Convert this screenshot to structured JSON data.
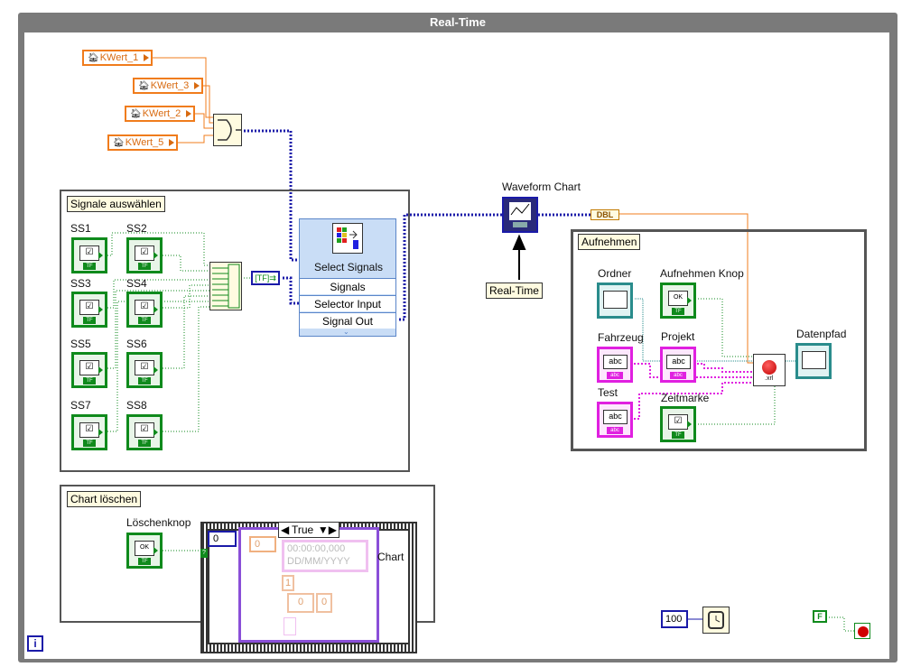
{
  "window": {
    "title": "Real-Time"
  },
  "constants": [
    {
      "label": "KWert_1"
    },
    {
      "label": "KWert_3"
    },
    {
      "label": "KWert_2"
    },
    {
      "label": "KWert_5"
    }
  ],
  "signals_struct": {
    "title": "Signale auswählen",
    "switches": [
      "SS1",
      "SS2",
      "SS3",
      "SS4",
      "SS5",
      "SS6",
      "SS7",
      "SS8"
    ]
  },
  "select_signals": {
    "title": "Select Signals",
    "ports": [
      "Signals",
      "Selector Input",
      "Signal Out"
    ]
  },
  "waveform": {
    "label": "Waveform Chart",
    "dbl": "DBL",
    "realtime_label": "Real-Time"
  },
  "record_struct": {
    "title": "Aufnehmen",
    "ordner": "Ordner",
    "aufnehmen_knop": "Aufnehmen Knop",
    "fahrzeug": "Fahrzeug",
    "projekt": "Projekt",
    "test": "Test",
    "zeitmarke": "Zeitmarke",
    "datenpfad": "Datenpfad"
  },
  "chart_struct": {
    "title": "Chart löschen",
    "loeschen": "Löschenknop",
    "case_value": "True",
    "index_val": "0",
    "inner_index": "0",
    "time_text": "00:00:00,000",
    "date_text": "DD/MM/YYYY",
    "one": "1",
    "zero_a": "0",
    "zero_b": "0",
    "chart_label": "Chart"
  },
  "wait": {
    "value": "100"
  },
  "stop": {
    "value": "F"
  },
  "info": {
    "icon": "i"
  },
  "colors": {
    "frame": "#7a7a7a",
    "bool": "#0f8a1c",
    "string": "#e020e0",
    "const": "#f07c1c",
    "dyn": "#1a1aa8",
    "path": "#2a8c8c"
  }
}
